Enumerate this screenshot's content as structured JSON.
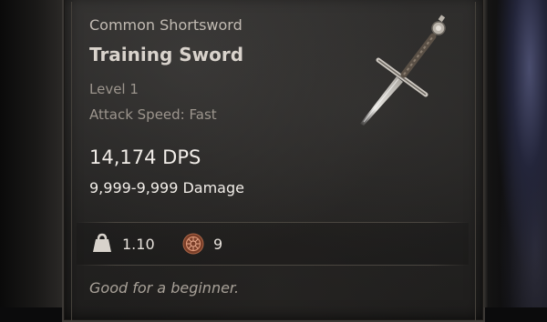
{
  "tooltip": {
    "category": "Common Shortsword",
    "name": "Training Sword",
    "level": "Level 1",
    "attack_speed": "Attack Speed: Fast",
    "dps": "14,174 DPS",
    "damage": "9,999-9,999 Damage",
    "weight": "1.10",
    "sell_value": "9",
    "flavor_text": "Good for a beginner.",
    "icons": {
      "item": "shortsword-icon",
      "weight": "weight-icon",
      "value": "coin-icon"
    }
  },
  "colors": {
    "category": "#c2bbb3",
    "name": "#d9d3cc",
    "secondary": "#9c958d",
    "stat": "#f1ede8",
    "coin": "#8a4a32"
  }
}
